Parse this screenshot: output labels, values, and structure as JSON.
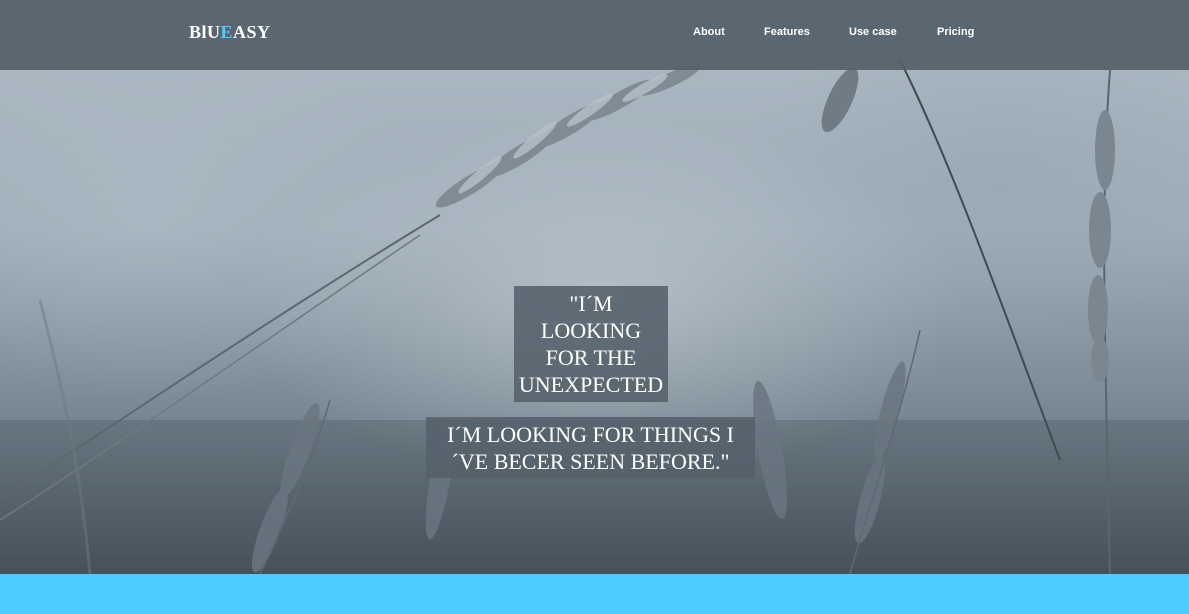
{
  "brand": {
    "logo_pre": "BlU",
    "logo_accent": "E",
    "logo_post": "ASY",
    "accent_color": "#4ecbff"
  },
  "nav": {
    "items": [
      {
        "label": "About"
      },
      {
        "label": "Features"
      },
      {
        "label": "Use case"
      },
      {
        "label": "Pricing"
      }
    ]
  },
  "hero": {
    "quote_lines": [
      "\"I´M",
      "LOOKING",
      "FOR THE",
      "UNEXPECTED"
    ],
    "sub_lines": [
      "I´M LOOKING FOR THINGS I",
      "´VE BECER SEEN BEFORE.\""
    ],
    "overlay_color": "#54616b",
    "background_image": "grass-stalks-photo"
  },
  "footer_band": {
    "color": "#4ecbff"
  }
}
